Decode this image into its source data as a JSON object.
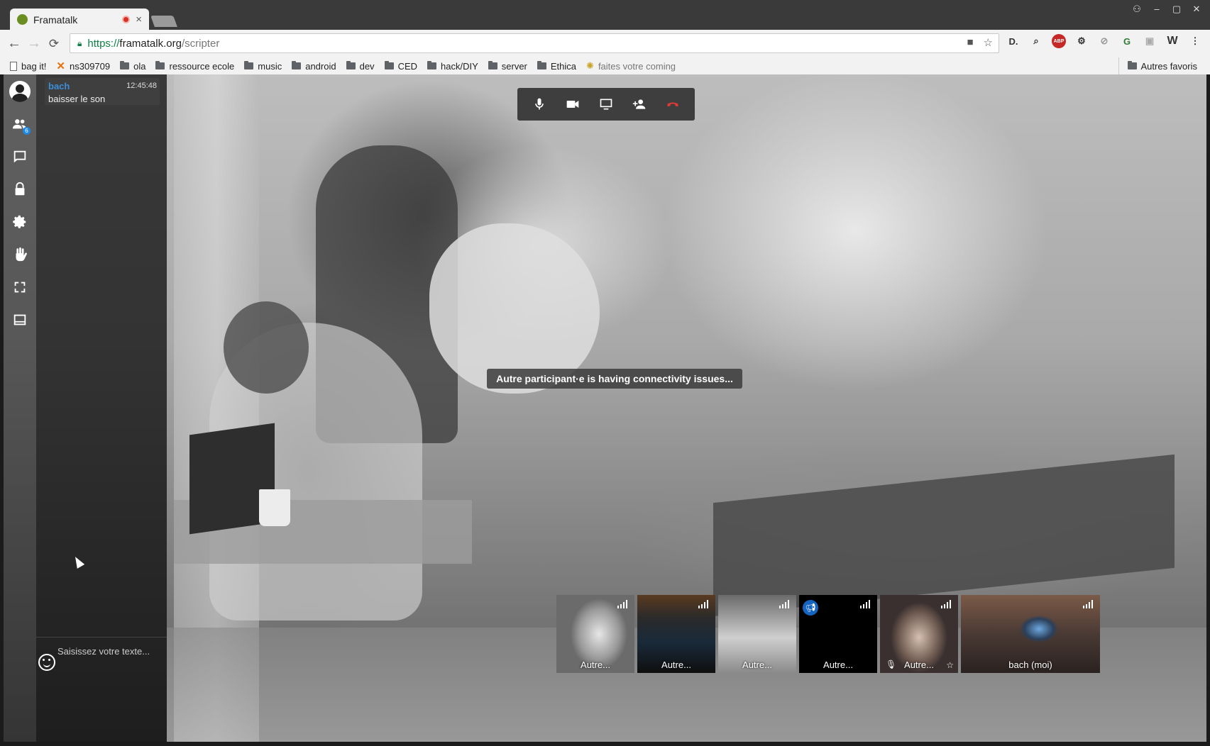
{
  "browser": {
    "tab_title": "Framatalk",
    "close_glyph": "×",
    "url_protocol": "https://",
    "url_host": "framatalk.org",
    "url_path": "/scripter",
    "bookmarks": [
      {
        "label": "bag it!",
        "icon": "page"
      },
      {
        "label": "ns309709",
        "icon": "x"
      },
      {
        "label": "ola",
        "icon": "folder"
      },
      {
        "label": "ressource ecole",
        "icon": "folder"
      },
      {
        "label": "music",
        "icon": "folder"
      },
      {
        "label": "android",
        "icon": "folder"
      },
      {
        "label": "dev",
        "icon": "folder"
      },
      {
        "label": "CED",
        "icon": "folder"
      },
      {
        "label": "hack/DIY",
        "icon": "folder"
      },
      {
        "label": "server",
        "icon": "folder"
      },
      {
        "label": "Ethica",
        "icon": "folder"
      },
      {
        "label": "faites votre coming",
        "icon": "sun"
      }
    ],
    "other_bookmarks": "Autres favoris",
    "extensions": [
      "D.",
      "search-ext",
      "ABP",
      "gear-ext",
      "disabled-ext",
      "G",
      "save-ext",
      "W"
    ]
  },
  "sidebar": {
    "participants_badge": "6",
    "icons": [
      "profile-icon",
      "participants-icon",
      "chat-icon",
      "lock-icon",
      "settings-icon",
      "raise-hand-icon",
      "fullscreen-icon",
      "filmstrip-icon"
    ]
  },
  "chat": {
    "messages": [
      {
        "name": "bach",
        "time": "12:45:48",
        "text": "baisser le son"
      }
    ],
    "input_placeholder": "Saisissez votre texte..."
  },
  "call_toolbar": [
    "microphone-icon",
    "camera-icon",
    "screen-share-icon",
    "invite-icon",
    "hangup-icon"
  ],
  "notice": "Autre participant·e is having connectivity issues...",
  "thumbnails": [
    {
      "label": "Autre..."
    },
    {
      "label": "Autre..."
    },
    {
      "label": "Autre..."
    },
    {
      "label": "Autre..."
    },
    {
      "label": "Autre..."
    },
    {
      "label": "bach (moi)"
    }
  ],
  "colors": {
    "accent_blue": "#3b8ed8",
    "hangup_red": "#e53935",
    "secure_green": "#0b8043"
  }
}
